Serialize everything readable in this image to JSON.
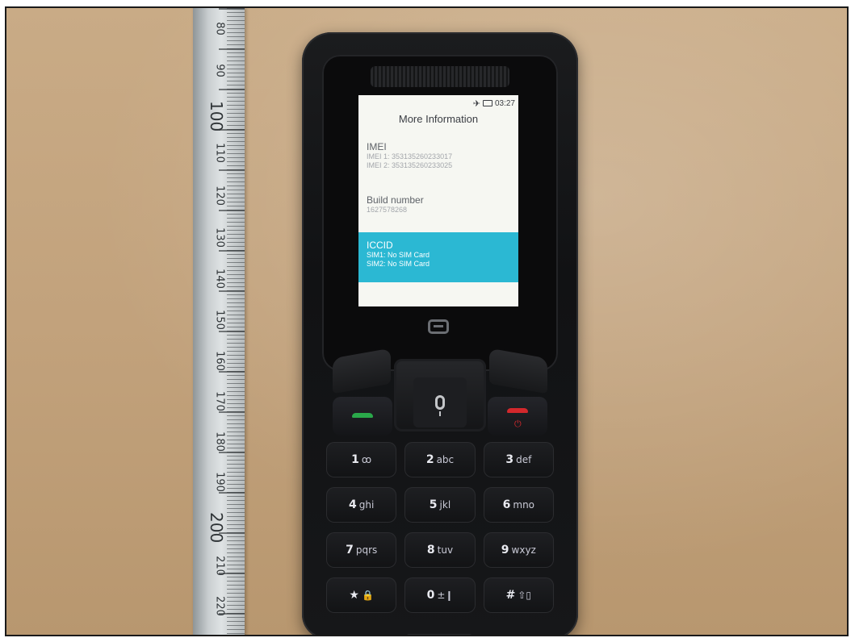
{
  "ruler": {
    "numbers": [
      "80",
      "90",
      "100",
      "110",
      "120",
      "130",
      "140",
      "150",
      "160",
      "170",
      "180",
      "190",
      "200",
      "210",
      "220"
    ]
  },
  "screen": {
    "status_time": "03:27",
    "title": "More Information",
    "imei_label": "IMEI",
    "imei1": "IMEI 1: 353135260233017",
    "imei2": "IMEI 2: 353135260233025",
    "build_label": "Build number",
    "build_value": "1627578268",
    "iccid_label": "ICCID",
    "sim1": "SIM1: No SIM Card",
    "sim2": "SIM2: No SIM Card"
  },
  "keys": [
    {
      "digit": "1",
      "letters": "ꝏ"
    },
    {
      "digit": "2",
      "letters": "abc"
    },
    {
      "digit": "3",
      "letters": "def"
    },
    {
      "digit": "4",
      "letters": "ghi"
    },
    {
      "digit": "5",
      "letters": "jkl"
    },
    {
      "digit": "6",
      "letters": "mno"
    },
    {
      "digit": "7",
      "letters": "pqrs"
    },
    {
      "digit": "8",
      "letters": "tuv"
    },
    {
      "digit": "9",
      "letters": "wxyz"
    },
    {
      "digit": "★",
      "letters": "🔒"
    },
    {
      "digit": "0",
      "letters": "±❙"
    },
    {
      "digit": "#",
      "letters": "⇧▯"
    }
  ],
  "colors": {
    "highlight": "#2bb8d3",
    "call_green": "#2aa84a",
    "end_red": "#d3282c"
  }
}
